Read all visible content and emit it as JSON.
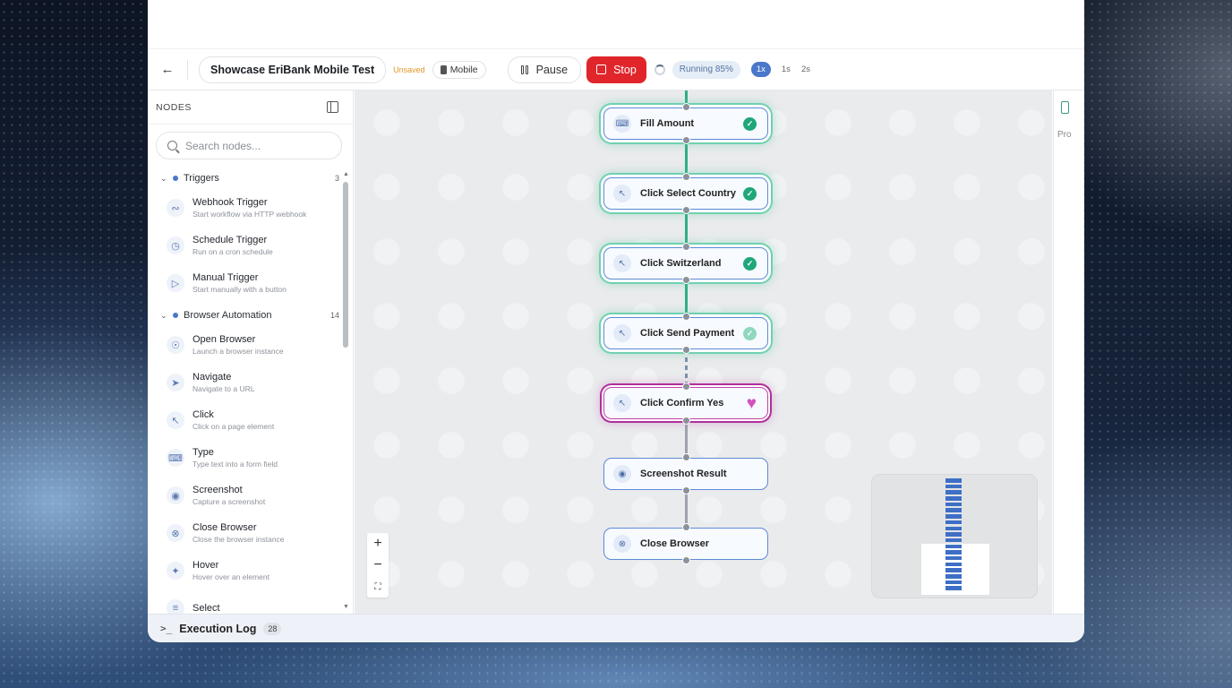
{
  "toolbar": {
    "title": "Showcase EriBank Mobile Test",
    "unsaved": "Unsaved",
    "device": "Mobile",
    "pause_label": "Pause",
    "stop_label": "Stop",
    "status": "Running 85%",
    "progress_percent": 85,
    "speeds": [
      "1x",
      "1s",
      "2s"
    ],
    "active_speed": "1x"
  },
  "sidebar": {
    "header": "NODES",
    "search_placeholder": "Search nodes...",
    "groups": [
      {
        "name": "Triggers",
        "count": "3",
        "items": [
          {
            "name": "Webhook Trigger",
            "desc": "Start workflow via HTTP webhook",
            "icon": "webhook-icon"
          },
          {
            "name": "Schedule Trigger",
            "desc": "Run on a cron schedule",
            "icon": "clock-icon"
          },
          {
            "name": "Manual Trigger",
            "desc": "Start manually with a button",
            "icon": "play-icon"
          }
        ]
      },
      {
        "name": "Browser Automation",
        "count": "14",
        "items": [
          {
            "name": "Open Browser",
            "desc": "Launch a browser instance",
            "icon": "globe-icon"
          },
          {
            "name": "Navigate",
            "desc": "Navigate to a URL",
            "icon": "navigate-icon"
          },
          {
            "name": "Click",
            "desc": "Click on a page element",
            "icon": "cursor-icon"
          },
          {
            "name": "Type",
            "desc": "Type text into a form field",
            "icon": "keyboard-icon"
          },
          {
            "name": "Screenshot",
            "desc": "Capture a screenshot",
            "icon": "camera-icon"
          },
          {
            "name": "Close Browser",
            "desc": "Close the browser instance",
            "icon": "close-circle-icon"
          },
          {
            "name": "Hover",
            "desc": "Hover over an element",
            "icon": "hover-icon"
          },
          {
            "name": "Select",
            "desc": "",
            "icon": "select-icon"
          }
        ]
      }
    ]
  },
  "flow": {
    "nodes": [
      {
        "label": "Fill Amount",
        "state": "done",
        "icon": "keyboard-icon"
      },
      {
        "label": "Click Select Country",
        "state": "done",
        "icon": "cursor-icon"
      },
      {
        "label": "Click Switzerland",
        "state": "done",
        "icon": "cursor-icon"
      },
      {
        "label": "Click Send Payment",
        "state": "done-light",
        "icon": "cursor-icon"
      },
      {
        "label": "Click Confirm Yes",
        "state": "active",
        "icon": "cursor-icon"
      },
      {
        "label": "Screenshot Result",
        "state": "pending",
        "icon": "camera-icon"
      },
      {
        "label": "Close Browser",
        "state": "pending",
        "icon": "close-circle-icon"
      }
    ]
  },
  "right_panel": {
    "tab": "Pro"
  },
  "log": {
    "label": "Execution Log",
    "count": "28"
  },
  "colors": {
    "accent": "#4a77c9",
    "stop": "#e0262b",
    "success": "#1fa77a",
    "active": "#c342a8",
    "unsaved": "#e0972a"
  }
}
